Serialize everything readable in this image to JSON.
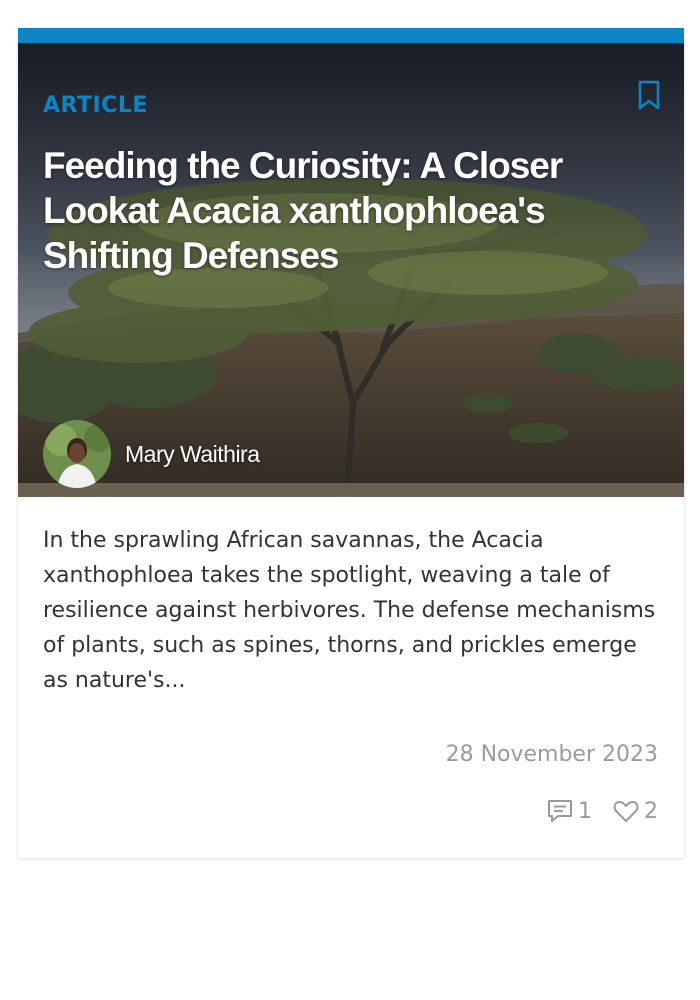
{
  "card": {
    "category": "ARTICLE",
    "title": "Feeding the Curiosity: A Closer Lookat Acacia xanthophloea's Shifting Defenses",
    "author": "Mary Waithira",
    "excerpt": "In the sprawling African savannas, the Acacia xanthophloea takes the spotlight, weaving a tale of resilience against herbivores. The defense mechanisms of plants, such as spines, thorns, and prickles emerge as nature's...",
    "date": "28 November 2023",
    "comments_count": "1",
    "likes_count": "2"
  },
  "colors": {
    "accent": "#0d84c4",
    "text": "#333333",
    "muted": "#9a9a9a"
  },
  "icons": [
    "bookmark-icon",
    "comment-icon",
    "heart-icon"
  ]
}
